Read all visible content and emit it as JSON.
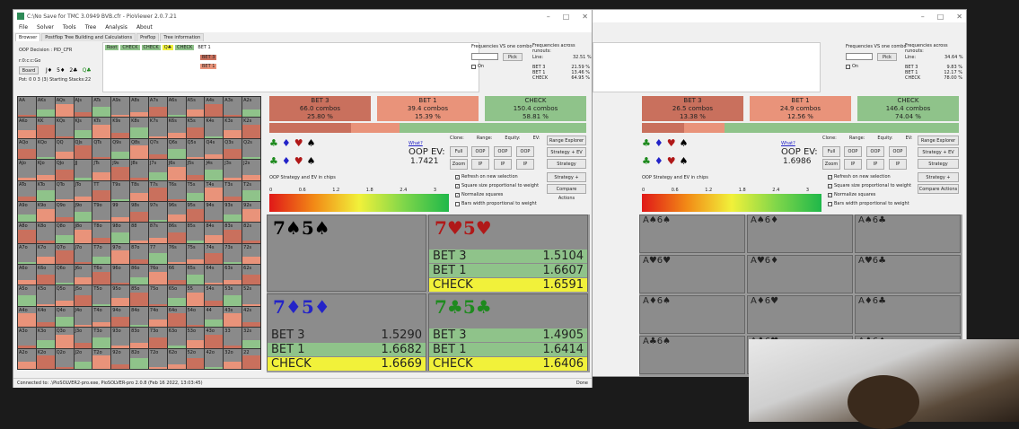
{
  "window_main": {
    "title": "C:\\No Save for TMC 3.0949 BVB.cfr - PioViewer 2.0.7.21",
    "menu": [
      "File",
      "Solver",
      "Tools",
      "Tree",
      "Analysis",
      "About"
    ],
    "tabs": [
      "Browser",
      "Postflop Tree Building and Calculations",
      "Preflop",
      "Tree information"
    ],
    "oop_decision": "OOP Decision : PID_CFR",
    "path": "r:0:c:c:Go",
    "board_label": "Board",
    "board_cards": [
      "J♦",
      "5♦",
      "2♣",
      "Q♣"
    ],
    "pot_info": "Pot: 0 0 3 (3) Starting Stacks:22",
    "tree_nodes": [
      "Root",
      "CHECK",
      "CHECK",
      "Q♣",
      "CHECK",
      "BET 1"
    ],
    "tree_children": [
      "BET 3",
      "BET 1"
    ],
    "freq_vs_label": "Frequencies VS one combo",
    "pick_label": "Pick",
    "on_label": "On",
    "freq_across_label": "Frequencies across runouts:",
    "line_label": "Line:",
    "line_value": "32.51 %",
    "freqs": [
      {
        "name": "BET 3",
        "value": "21.59 %"
      },
      {
        "name": "BET 1",
        "value": "13.46 %"
      },
      {
        "name": "CHECK",
        "value": "64.95 %"
      }
    ],
    "actions": [
      {
        "name": "BET 3",
        "combos": "66.0 combos",
        "pct": "25.80 %",
        "color": "#c9705d"
      },
      {
        "name": "BET 1",
        "combos": "39.4 combos",
        "pct": "15.39 %",
        "color": "#e9937a"
      },
      {
        "name": "CHECK",
        "combos": "150.4 combos",
        "pct": "58.81 %",
        "color": "#8fc38a"
      }
    ],
    "what_link": "What?",
    "oop_ev_label": "OOP EV:",
    "oop_ev_value": "1.7421",
    "col_headers": [
      "Clone:",
      "Range:",
      "Equity:",
      "EV:"
    ],
    "buttons_row1": [
      "Full",
      "OOP",
      "OOP",
      "OOP"
    ],
    "buttons_row2": [
      "Zoom",
      "IP",
      "IP",
      "IP"
    ],
    "side_buttons": [
      "Range Explorer",
      "Strategy + EV",
      "Strategy",
      "Strategy + Reach",
      "Compare Actions"
    ],
    "checkboxes": [
      {
        "label": "Refresh on new selection",
        "checked": true
      },
      {
        "label": "Square size proportional to weight",
        "checked": true
      },
      {
        "label": "Normalize squares",
        "checked": true
      },
      {
        "label": "Bars width proportional to weight",
        "checked": false
      }
    ],
    "legend_title": "OOP Strategy and EV in chips",
    "scale_ticks": [
      "0",
      "0.6",
      "1.2",
      "1.8",
      "2.4",
      "3"
    ],
    "status_bar": "Connected to: .\\PioSOLVER2-pro.exe, PioSOLVER-pro 2.0.8 (Feb 16 2022, 13:03:45)",
    "done_label": "Done"
  },
  "runouts_main": [
    {
      "hand": "7♠5♠",
      "color": "#000",
      "rows": []
    },
    {
      "hand": "7♥5♥",
      "color": "#b01818",
      "rows": [
        {
          "name": "BET 3",
          "value": "1.5104",
          "bg": "#8fc38a"
        },
        {
          "name": "BET 1",
          "value": "1.6607",
          "bg": "#8fc38a"
        },
        {
          "name": "CHECK",
          "value": "1.6591",
          "bg": "#f1f13a"
        }
      ]
    },
    {
      "hand": "7♦5♦",
      "color": "#2323c8",
      "rows": [
        {
          "name": "BET 3",
          "value": "1.5290",
          "bg": "#8c8c8c"
        },
        {
          "name": "BET 1",
          "value": "1.6682",
          "bg": "#8fc38a"
        },
        {
          "name": "CHECK",
          "value": "1.6669",
          "bg": "#f1f13a"
        }
      ]
    },
    {
      "hand": "7♣5♣",
      "color": "#1e8a1e",
      "rows": [
        {
          "name": "BET 3",
          "value": "1.4905",
          "bg": "#8fc38a"
        },
        {
          "name": "BET 1",
          "value": "1.6414",
          "bg": "#8fc38a"
        },
        {
          "name": "CHECK",
          "value": "1.6406",
          "bg": "#f1f13a"
        }
      ]
    }
  ],
  "window_second": {
    "freq_vs_label": "Frequencies VS one combo",
    "pick_label": "Pick",
    "on_label": "On",
    "freq_across_label": "Frequencies across runouts:",
    "line_label": "Line:",
    "line_value": "34.64 %",
    "freqs": [
      {
        "name": "BET 3",
        "value": "9.83 %"
      },
      {
        "name": "BET 1",
        "value": "12.17 %"
      },
      {
        "name": "CHECK",
        "value": "78.00 %"
      }
    ],
    "actions": [
      {
        "name": "BET 3",
        "combos": "26.5 combos",
        "pct": "13.38 %",
        "color": "#c9705d"
      },
      {
        "name": "BET 1",
        "combos": "24.9 combos",
        "pct": "12.56 %",
        "color": "#e9937a"
      },
      {
        "name": "CHECK",
        "combos": "146.4 combos",
        "pct": "74.04 %",
        "color": "#8fc38a"
      }
    ],
    "what_link": "What?",
    "oop_ev_label": "OOP EV:",
    "oop_ev_value": "1.6986",
    "legend_title": "OOP Strategy and EV in chips",
    "runouts": [
      "A♠6♠",
      "A♠6♦",
      "A♠6♣",
      "A♥6♥",
      "A♥6♦",
      "A♥6♣",
      "A♦6♠",
      "A♦6♥",
      "A♦6♣",
      "A♣6♠",
      "A♣6♥",
      "A♣6♦"
    ]
  },
  "grid_ranks": [
    "A",
    "K",
    "Q",
    "J",
    "T",
    "9",
    "8",
    "7",
    "6",
    "5",
    "4",
    "3",
    "2"
  ],
  "colors": {
    "bet3": "#c9705d",
    "bet1": "#e9937a",
    "check": "#8fc38a",
    "bg_grid": "#8a8a8a"
  }
}
